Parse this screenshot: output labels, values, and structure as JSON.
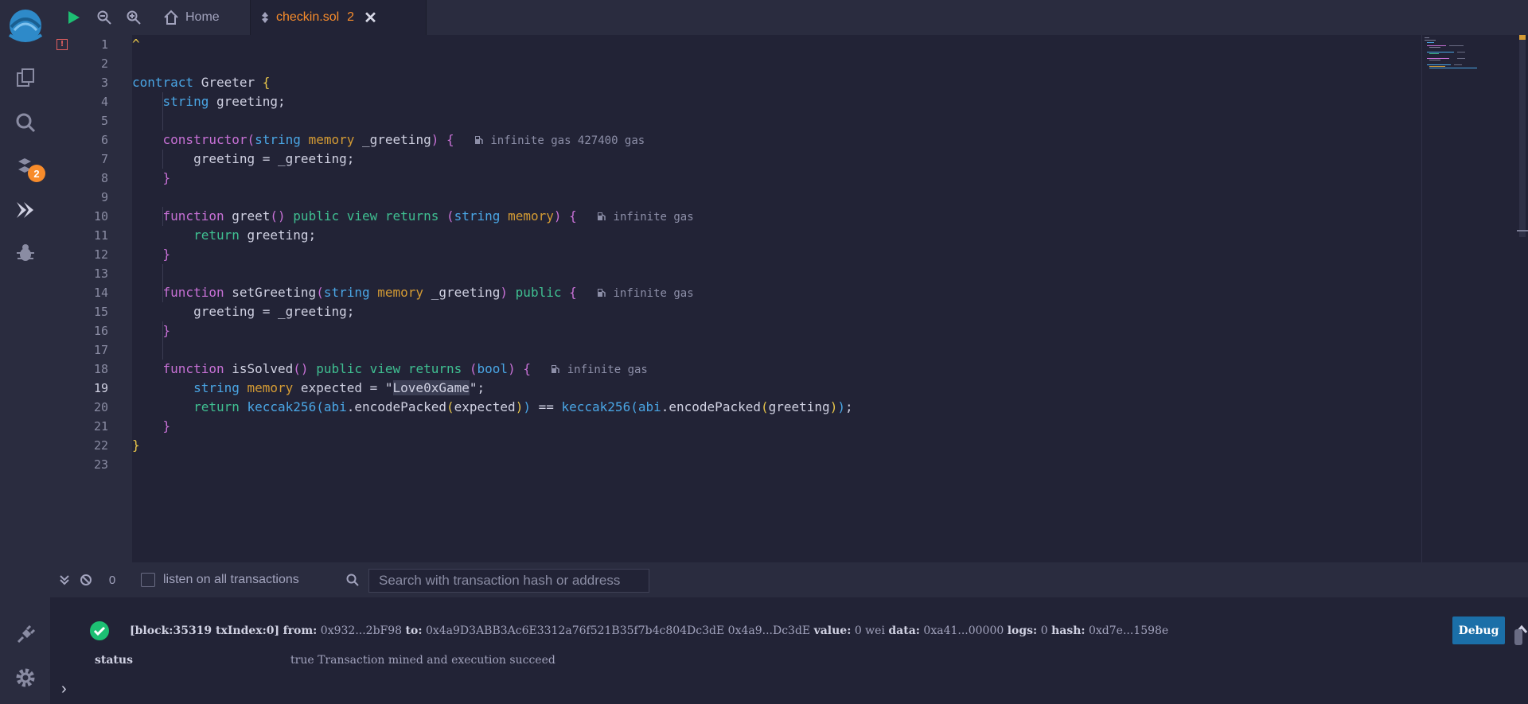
{
  "topbar": {
    "home_label": "Home",
    "file_tab_label": "checkin.sol",
    "file_tab_count": "2"
  },
  "iconbar": {
    "git_badge": "2"
  },
  "editor": {
    "line_numbers": [
      "1",
      "2",
      "3",
      "4",
      "5",
      "6",
      "7",
      "8",
      "9",
      "10",
      "11",
      "12",
      "13",
      "14",
      "15",
      "16",
      "17",
      "18",
      "19",
      "20",
      "21",
      "22",
      "23"
    ],
    "active_line": "19",
    "line1_caret": "^",
    "gas_constructor": "infinite gas 427400 gas",
    "gas_greet": "infinite gas",
    "gas_setGreeting": "infinite gas",
    "gas_isSolved": "infinite gas"
  },
  "terminal": {
    "tx_count": "0",
    "listen_label": "listen on all transactions",
    "search_placeholder": "Search with transaction hash or address",
    "log_block": "[block:35319 txIndex:0]",
    "from_label": "from:",
    "from_value": "0x932...2bF98",
    "to_label": "to:",
    "to_value": "0x4a9D3ABB3Ac6E3312a76f521B35f7b4c804Dc3dE 0x4a9...Dc3dE",
    "value_label": "value:",
    "value_value": "0 wei",
    "data_label": "data:",
    "data_value": "0xa41...00000",
    "logs_label": "logs:",
    "logs_value": "0",
    "hash_label": "hash:",
    "hash_value": "0xd7e...1598e",
    "debug_label": "Debug",
    "status_label": "status",
    "status_value": "true Transaction mined and execution succeed",
    "prompt": "›"
  },
  "colors": {
    "accent": "#f88c2b",
    "background": "#222336",
    "panel": "#2a2c3f",
    "keyword": "#4aa6e5",
    "memory": "#d49b34",
    "returns": "#3fbf91",
    "success": "#1dbf73"
  }
}
